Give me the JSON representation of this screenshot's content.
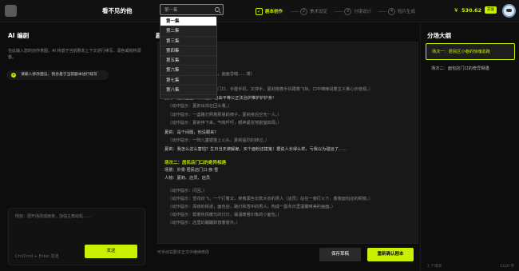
{
  "app": {
    "title": "看不见的他"
  },
  "search": {
    "query": "第一集"
  },
  "steps": [
    {
      "label": "剧本创作",
      "state": "done"
    },
    {
      "label": "美术设定",
      "num": "2"
    },
    {
      "label": "分镜设计",
      "num": "3"
    },
    {
      "label": "短片生成",
      "num": "4"
    }
  ],
  "account": {
    "balance": "530.62",
    "topup": "充值"
  },
  "left": {
    "heading": "AI 编剧",
    "desc": "在此输入您的创作意图，AI 将基于当前剧本上下文进行续写、润色或结构调整。",
    "suggestion": "请输入修改建议，我会基于当前剧本进行续写",
    "input_placeholder": "例如：把开场改成雨夜，加强主角动机……",
    "hint": "Ctrl/Cmd + Enter 发送",
    "send": "发送"
  },
  "center": {
    "heading": "剧本",
    "lines": [
      {
        "t": "的哭声。",
        "c": "dim"
      },
      {
        "t": "（画面提示：镜头缓缓推进，画面昏暗……萧）",
        "c": "dim"
      },
      {
        "t": "——",
        "c": "dim"
      },
      {
        "t": "（动作提示：夏莉站在主卧门口，手握手机，又停手，夏莉抱着手机跟着飞快，口中喃喃说着主义推心价值观。）",
        "c": "dim"
      },
      {
        "t": "夏莉：居民区主义和机器，自由平等公正法治护推护护护身！",
        "c": ""
      },
      {
        "t": "（动作提示：夏莉出现在回头看。）",
        "c": "dim"
      },
      {
        "t": "（动作提示：一盏路灯照着那悬的椅子，夏莉身后空无一人。）",
        "c": "dim"
      },
      {
        "t": "（动作提示：夏莉停下来，气喘吁吁，眼神紧张地掀望四周。）",
        "c": "dim"
      },
      {
        "t": "夏莉：是个间题，他没跟来？",
        "c": ""
      },
      {
        "t": "（动作提示：一阵儿童银笛上心头，夏莉猛烈的转过。）",
        "c": "dim"
      },
      {
        "t": "夏莉：我怎么这么害怕？生日当天被解雇，买个面粉还撞鬼！据说人长得么样，亏我以为碰运了……",
        "c": ""
      },
      {
        "t": "场次二：居民店门口的奇异相遇",
        "c": "green"
      },
      {
        "t": "场景：外景·居民店门口·夜·雪",
        "c": ""
      },
      {
        "t": "人物：夏莉、店员、店员",
        "c": ""
      },
      {
        "t": "（动作提示：闪回。）",
        "c": "dim"
      },
      {
        "t": "（动作提示：雪花纷飞，一个打着伞，穿着黑色长款大衣的男人（店员）站在一旁打火下，着着面包店的橱窗。）",
        "c": "dim"
      },
      {
        "t": "（动作提示：深夜的街道，面包店，路灯和雪中的男人，构成一副冬日里温馨唯美的画面。）",
        "c": "dim"
      },
      {
        "t": "（动作提示：帮着热情暖光的灯灯，最温暖着印象的小面包。）",
        "c": "dim"
      },
      {
        "t": "（动作提示：店里的蹦蹦转悠着窗外。）",
        "c": "dim"
      }
    ],
    "footer": "可手动在剧本正文中继续修改",
    "save": "保存草稿",
    "confirm": "重新确认剧本"
  },
  "right": {
    "heading": "分场大纲",
    "scenes": [
      "场次一：居民区小巷的惊魂逃跑",
      "场次二：面包店门口的奇异相遇"
    ],
    "count": "2 个场次",
    "chars": "1220 字"
  },
  "episodes": [
    "第一集",
    "第二集",
    "第三集",
    "第四集",
    "第五集",
    "第六集",
    "第七集",
    "第八集"
  ]
}
